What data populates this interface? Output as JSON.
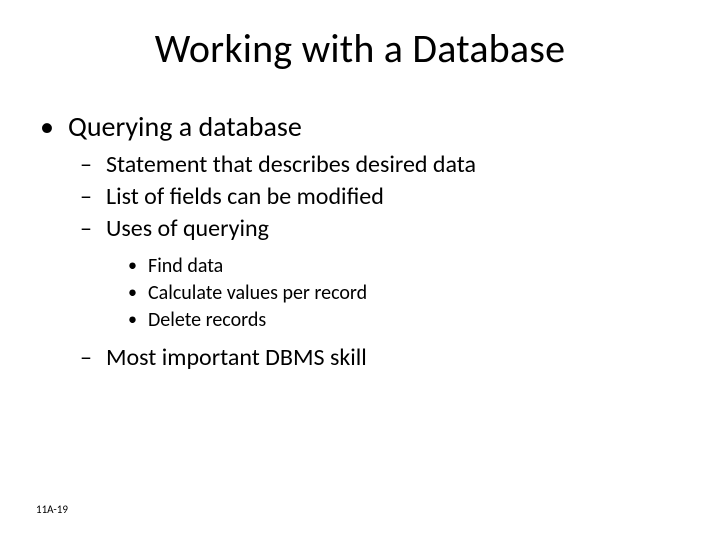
{
  "slide": {
    "title": "Working with a Database",
    "bullets": {
      "l1_0": "Querying a database",
      "l2_0": "Statement that describes desired data",
      "l2_1": "List of fields can be modified",
      "l2_2": "Uses of querying",
      "l3_0": "Find data",
      "l3_1": "Calculate values per record",
      "l3_2": "Delete records",
      "l2_3": "Most important DBMS skill"
    },
    "footer": "11A-19"
  }
}
